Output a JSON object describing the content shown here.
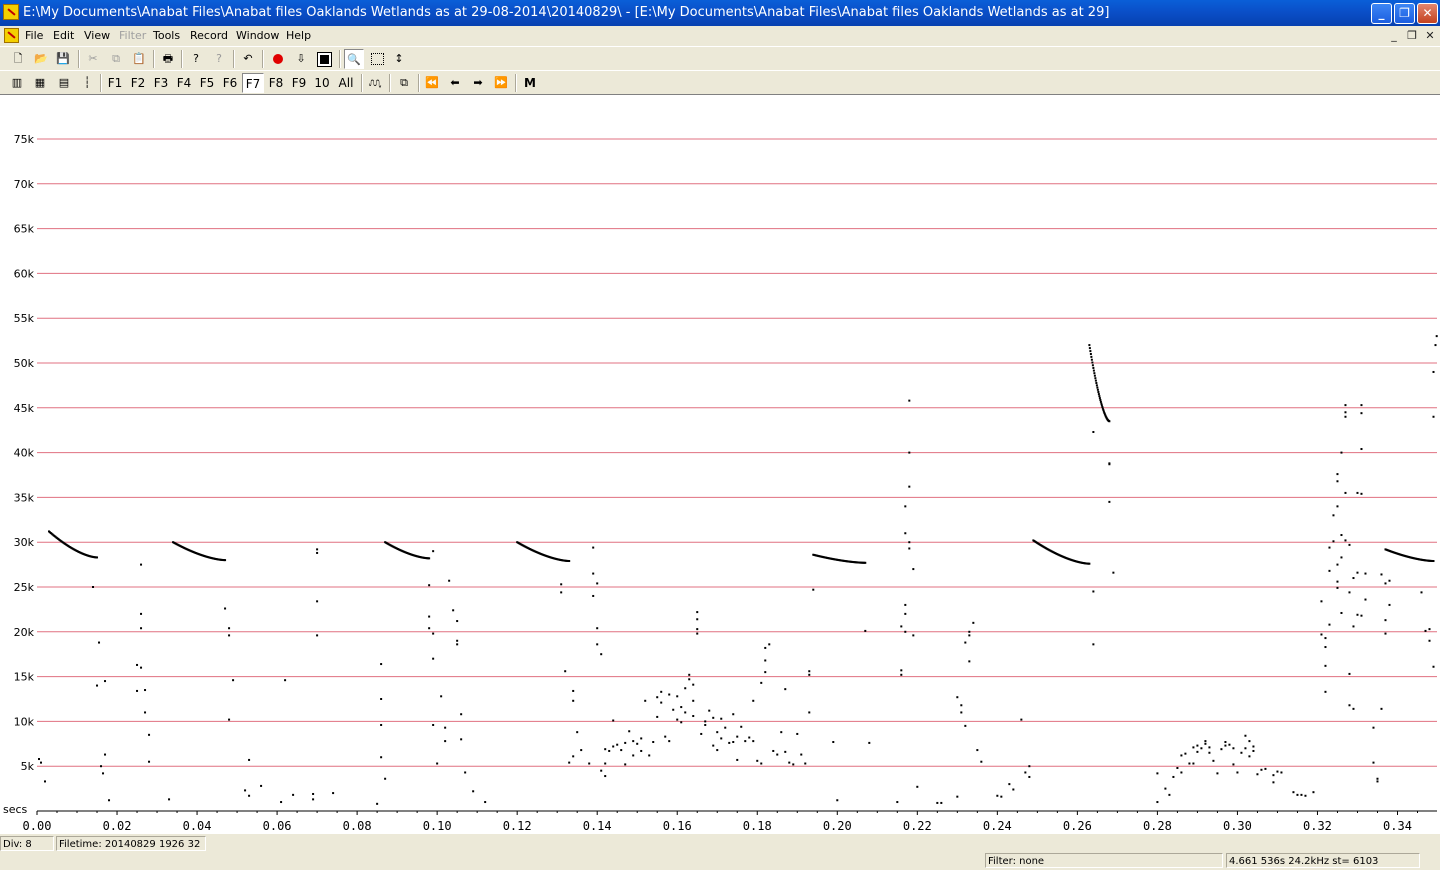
{
  "window": {
    "title": "E:\\My Documents\\Anabat Files\\Anabat files Oaklands Wetlands as at 29-08-2014\\20140829\\ - [E:\\My Documents\\Anabat Files\\Anabat files Oaklands Wetlands as at 29]",
    "controls": [
      "minimize",
      "maximize",
      "close"
    ]
  },
  "menu": {
    "items": [
      "File",
      "Edit",
      "View",
      "Filter",
      "Tools",
      "Record",
      "Window",
      "Help"
    ],
    "disabled": [
      "Filter"
    ]
  },
  "toolbar1": {
    "icons": [
      "new-file-icon",
      "open-folder-icon",
      "save-icon",
      "cut-icon",
      "copy-icon",
      "paste-icon",
      "print-icon",
      "help-icon",
      "context-help-icon",
      "undo-icon",
      "record-icon",
      "download-icon",
      "stop-icon",
      "zoom-icon",
      "select-rect-icon",
      "vertical-arrow-icon"
    ]
  },
  "toolbar2": {
    "view_icons": [
      "view-mode-1-icon",
      "view-mode-2-icon",
      "view-mode-3-icon",
      "view-mode-4-icon"
    ],
    "file_buttons": [
      "F1",
      "F2",
      "F3",
      "F4",
      "F5",
      "F6",
      "F7",
      "F8",
      "F9",
      "10",
      "All"
    ],
    "active_file": "F7",
    "nav_icons": [
      "call-shape-icon",
      "compare-icon",
      "first-icon",
      "prev-icon",
      "next-icon",
      "last-icon"
    ],
    "m_label": "M"
  },
  "chart_data": {
    "type": "scatter",
    "xlabel": "secs",
    "ylabel": "",
    "xlim": [
      0.0,
      0.35
    ],
    "ylim": [
      0,
      80000
    ],
    "x_ticks": [
      "0.00",
      "0.02",
      "0.04",
      "0.06",
      "0.08",
      "0.10",
      "0.12",
      "0.14",
      "0.16",
      "0.18",
      "0.20",
      "0.22",
      "0.24",
      "0.26",
      "0.28",
      "0.30",
      "0.32",
      "0.34"
    ],
    "y_ticks": [
      "5k",
      "10k",
      "15k",
      "20k",
      "25k",
      "30k",
      "35k",
      "40k",
      "45k",
      "50k",
      "55k",
      "60k",
      "65k",
      "70k",
      "75k"
    ],
    "grid": true,
    "grid_color": "#e07080",
    "calls": [
      {
        "x_start": 0.003,
        "x_end": 0.015,
        "f_start": 31200,
        "f_end": 28300
      },
      {
        "x_start": 0.034,
        "x_end": 0.047,
        "f_start": 30000,
        "f_end": 28000
      },
      {
        "x_start": 0.087,
        "x_end": 0.098,
        "f_start": 30000,
        "f_end": 28200
      },
      {
        "x_start": 0.12,
        "x_end": 0.133,
        "f_start": 30000,
        "f_end": 27900
      },
      {
        "x_start": 0.194,
        "x_end": 0.207,
        "f_start": 28600,
        "f_end": 27700
      },
      {
        "x_start": 0.249,
        "x_end": 0.263,
        "f_start": 30200,
        "f_end": 27600
      },
      {
        "x_start": 0.263,
        "x_end": 0.268,
        "f_start": 52000,
        "f_end": 43500
      },
      {
        "x_start": 0.337,
        "x_end": 0.349,
        "f_start": 29200,
        "f_end": 27900
      }
    ],
    "noise_points": [
      [
        0.0005,
        5800
      ],
      [
        0.001,
        5400
      ],
      [
        0.002,
        3300
      ],
      [
        0.014,
        25000
      ],
      [
        0.015,
        14000
      ],
      [
        0.0155,
        18800
      ],
      [
        0.016,
        5000
      ],
      [
        0.0165,
        4200
      ],
      [
        0.017,
        6300
      ],
      [
        0.017,
        14500
      ],
      [
        0.018,
        1200
      ],
      [
        0.025,
        13400
      ],
      [
        0.025,
        16300
      ],
      [
        0.026,
        16000
      ],
      [
        0.026,
        27500
      ],
      [
        0.026,
        22000
      ],
      [
        0.026,
        20400
      ],
      [
        0.027,
        13500
      ],
      [
        0.027,
        11000
      ],
      [
        0.028,
        8500
      ],
      [
        0.028,
        5500
      ],
      [
        0.033,
        1300
      ],
      [
        0.047,
        22600
      ],
      [
        0.048,
        20400
      ],
      [
        0.048,
        19600
      ],
      [
        0.048,
        10200
      ],
      [
        0.049,
        14600
      ],
      [
        0.052,
        2300
      ],
      [
        0.053,
        1700
      ],
      [
        0.053,
        5700
      ],
      [
        0.056,
        2800
      ],
      [
        0.061,
        1000
      ],
      [
        0.062,
        14600
      ],
      [
        0.064,
        1800
      ],
      [
        0.069,
        1300
      ],
      [
        0.069,
        1900
      ],
      [
        0.07,
        29200
      ],
      [
        0.07,
        28800
      ],
      [
        0.07,
        23400
      ],
      [
        0.07,
        19600
      ],
      [
        0.074,
        2000
      ],
      [
        0.085,
        800
      ],
      [
        0.086,
        6000
      ],
      [
        0.086,
        9600
      ],
      [
        0.086,
        12500
      ],
      [
        0.086,
        16400
      ],
      [
        0.087,
        3600
      ],
      [
        0.098,
        25200
      ],
      [
        0.098,
        21700
      ],
      [
        0.098,
        20400
      ],
      [
        0.099,
        29000
      ],
      [
        0.099,
        19800
      ],
      [
        0.099,
        17000
      ],
      [
        0.099,
        9600
      ],
      [
        0.1,
        5300
      ],
      [
        0.101,
        12800
      ],
      [
        0.102,
        9300
      ],
      [
        0.102,
        7800
      ],
      [
        0.103,
        25700
      ],
      [
        0.104,
        22400
      ],
      [
        0.105,
        21200
      ],
      [
        0.105,
        18600
      ],
      [
        0.105,
        19000
      ],
      [
        0.106,
        8000
      ],
      [
        0.106,
        10800
      ],
      [
        0.107,
        4300
      ],
      [
        0.109,
        2200
      ],
      [
        0.112,
        1000
      ],
      [
        0.131,
        24400
      ],
      [
        0.131,
        25300
      ],
      [
        0.132,
        15600
      ],
      [
        0.133,
        5400
      ],
      [
        0.134,
        6100
      ],
      [
        0.134,
        13400
      ],
      [
        0.134,
        12300
      ],
      [
        0.135,
        8800
      ],
      [
        0.136,
        6800
      ],
      [
        0.138,
        5300
      ],
      [
        0.139,
        29400
      ],
      [
        0.139,
        24000
      ],
      [
        0.139,
        26500
      ],
      [
        0.14,
        25400
      ],
      [
        0.14,
        20400
      ],
      [
        0.14,
        18600
      ],
      [
        0.141,
        17500
      ],
      [
        0.141,
        4500
      ],
      [
        0.142,
        3900
      ],
      [
        0.142,
        5300
      ],
      [
        0.142,
        6900
      ],
      [
        0.143,
        6700
      ],
      [
        0.144,
        10100
      ],
      [
        0.144,
        7200
      ],
      [
        0.145,
        7400
      ],
      [
        0.146,
        6800
      ],
      [
        0.147,
        5200
      ],
      [
        0.147,
        7600
      ],
      [
        0.148,
        8900
      ],
      [
        0.149,
        6200
      ],
      [
        0.149,
        7800
      ],
      [
        0.15,
        7500
      ],
      [
        0.151,
        6700
      ],
      [
        0.151,
        8100
      ],
      [
        0.152,
        12300
      ],
      [
        0.153,
        6200
      ],
      [
        0.154,
        7700
      ],
      [
        0.155,
        12700
      ],
      [
        0.155,
        10500
      ],
      [
        0.156,
        13300
      ],
      [
        0.156,
        12100
      ],
      [
        0.157,
        8300
      ],
      [
        0.158,
        13000
      ],
      [
        0.158,
        7800
      ],
      [
        0.159,
        11300
      ],
      [
        0.16,
        12800
      ],
      [
        0.16,
        10200
      ],
      [
        0.161,
        9900
      ],
      [
        0.161,
        11600
      ],
      [
        0.162,
        13700
      ],
      [
        0.162,
        11000
      ],
      [
        0.163,
        14700
      ],
      [
        0.163,
        15200
      ],
      [
        0.164,
        14100
      ],
      [
        0.164,
        12300
      ],
      [
        0.164,
        10600
      ],
      [
        0.165,
        20300
      ],
      [
        0.165,
        21400
      ],
      [
        0.165,
        22200
      ],
      [
        0.165,
        19800
      ],
      [
        0.166,
        8600
      ],
      [
        0.167,
        10000
      ],
      [
        0.167,
        9600
      ],
      [
        0.168,
        11200
      ],
      [
        0.169,
        10400
      ],
      [
        0.169,
        7300
      ],
      [
        0.17,
        8800
      ],
      [
        0.17,
        6800
      ],
      [
        0.171,
        8100
      ],
      [
        0.171,
        10300
      ],
      [
        0.172,
        9300
      ],
      [
        0.173,
        7600
      ],
      [
        0.174,
        7700
      ],
      [
        0.174,
        10800
      ],
      [
        0.175,
        8300
      ],
      [
        0.175,
        5700
      ],
      [
        0.176,
        9400
      ],
      [
        0.177,
        7800
      ],
      [
        0.178,
        8200
      ],
      [
        0.179,
        7800
      ],
      [
        0.179,
        12300
      ],
      [
        0.18,
        5600
      ],
      [
        0.181,
        5300
      ],
      [
        0.181,
        14300
      ],
      [
        0.182,
        15500
      ],
      [
        0.182,
        16800
      ],
      [
        0.182,
        18200
      ],
      [
        0.183,
        18600
      ],
      [
        0.184,
        6700
      ],
      [
        0.185,
        6300
      ],
      [
        0.186,
        8800
      ],
      [
        0.187,
        13600
      ],
      [
        0.187,
        6600
      ],
      [
        0.188,
        5400
      ],
      [
        0.189,
        5200
      ],
      [
        0.19,
        8600
      ],
      [
        0.191,
        6300
      ],
      [
        0.192,
        5300
      ],
      [
        0.193,
        11000
      ],
      [
        0.193,
        15600
      ],
      [
        0.193,
        15200
      ],
      [
        0.194,
        24700
      ],
      [
        0.199,
        7700
      ],
      [
        0.2,
        1200
      ],
      [
        0.207,
        20100
      ],
      [
        0.208,
        7600
      ],
      [
        0.215,
        1000
      ],
      [
        0.216,
        15200
      ],
      [
        0.216,
        15700
      ],
      [
        0.216,
        20600
      ],
      [
        0.217,
        20000
      ],
      [
        0.217,
        23000
      ],
      [
        0.217,
        22000
      ],
      [
        0.217,
        34000
      ],
      [
        0.217,
        31000
      ],
      [
        0.218,
        36200
      ],
      [
        0.218,
        45800
      ],
      [
        0.218,
        40000
      ],
      [
        0.218,
        30000
      ],
      [
        0.218,
        29300
      ],
      [
        0.219,
        27000
      ],
      [
        0.219,
        19600
      ],
      [
        0.22,
        2700
      ],
      [
        0.225,
        900
      ],
      [
        0.226,
        900
      ],
      [
        0.23,
        1600
      ],
      [
        0.23,
        12700
      ],
      [
        0.231,
        11800
      ],
      [
        0.231,
        11000
      ],
      [
        0.232,
        9500
      ],
      [
        0.232,
        18800
      ],
      [
        0.233,
        16700
      ],
      [
        0.233,
        20000
      ],
      [
        0.233,
        19600
      ],
      [
        0.234,
        21000
      ],
      [
        0.235,
        6800
      ],
      [
        0.236,
        5500
      ],
      [
        0.24,
        1700
      ],
      [
        0.241,
        1600
      ],
      [
        0.243,
        3000
      ],
      [
        0.244,
        2400
      ],
      [
        0.246,
        10200
      ],
      [
        0.247,
        4300
      ],
      [
        0.248,
        3800
      ],
      [
        0.248,
        5000
      ],
      [
        0.264,
        18600
      ],
      [
        0.264,
        24500
      ],
      [
        0.264,
        42300
      ],
      [
        0.268,
        38700
      ],
      [
        0.268,
        38800
      ],
      [
        0.268,
        34500
      ],
      [
        0.269,
        26600
      ],
      [
        0.28,
        4200
      ],
      [
        0.28,
        1000
      ],
      [
        0.282,
        2500
      ],
      [
        0.283,
        1800
      ],
      [
        0.284,
        3800
      ],
      [
        0.285,
        4800
      ],
      [
        0.286,
        4300
      ],
      [
        0.286,
        6200
      ],
      [
        0.287,
        6400
      ],
      [
        0.288,
        5300
      ],
      [
        0.289,
        5300
      ],
      [
        0.289,
        7100
      ],
      [
        0.29,
        7300
      ],
      [
        0.29,
        6600
      ],
      [
        0.291,
        7000
      ],
      [
        0.292,
        7800
      ],
      [
        0.292,
        7500
      ],
      [
        0.293,
        7100
      ],
      [
        0.293,
        6500
      ],
      [
        0.294,
        5600
      ],
      [
        0.295,
        4200
      ],
      [
        0.296,
        6900
      ],
      [
        0.297,
        7700
      ],
      [
        0.297,
        7300
      ],
      [
        0.298,
        7400
      ],
      [
        0.299,
        7000
      ],
      [
        0.299,
        5200
      ],
      [
        0.3,
        4300
      ],
      [
        0.301,
        6500
      ],
      [
        0.302,
        7000
      ],
      [
        0.302,
        8400
      ],
      [
        0.303,
        7800
      ],
      [
        0.303,
        6100
      ],
      [
        0.304,
        6700
      ],
      [
        0.304,
        7200
      ],
      [
        0.305,
        4100
      ],
      [
        0.306,
        4600
      ],
      [
        0.307,
        4700
      ],
      [
        0.309,
        3200
      ],
      [
        0.309,
        4000
      ],
      [
        0.31,
        4400
      ],
      [
        0.311,
        4300
      ],
      [
        0.314,
        2100
      ],
      [
        0.315,
        1800
      ],
      [
        0.316,
        1800
      ],
      [
        0.317,
        1700
      ],
      [
        0.319,
        2100
      ],
      [
        0.321,
        23400
      ],
      [
        0.321,
        19700
      ],
      [
        0.322,
        19300
      ],
      [
        0.322,
        18300
      ],
      [
        0.322,
        16200
      ],
      [
        0.322,
        13300
      ],
      [
        0.323,
        20800
      ],
      [
        0.323,
        26800
      ],
      [
        0.323,
        29400
      ],
      [
        0.324,
        30100
      ],
      [
        0.324,
        33000
      ],
      [
        0.325,
        36800
      ],
      [
        0.325,
        37600
      ],
      [
        0.325,
        34000
      ],
      [
        0.325,
        24900
      ],
      [
        0.325,
        25600
      ],
      [
        0.325,
        27500
      ],
      [
        0.326,
        40000
      ],
      [
        0.326,
        28300
      ],
      [
        0.326,
        22100
      ],
      [
        0.326,
        30800
      ],
      [
        0.327,
        44500
      ],
      [
        0.327,
        45300
      ],
      [
        0.327,
        44000
      ],
      [
        0.327,
        35500
      ],
      [
        0.327,
        30200
      ],
      [
        0.328,
        29700
      ],
      [
        0.328,
        24400
      ],
      [
        0.328,
        15300
      ],
      [
        0.328,
        11800
      ],
      [
        0.329,
        11400
      ],
      [
        0.329,
        20600
      ],
      [
        0.329,
        26000
      ],
      [
        0.33,
        35500
      ],
      [
        0.33,
        26600
      ],
      [
        0.33,
        21900
      ],
      [
        0.331,
        45300
      ],
      [
        0.331,
        44400
      ],
      [
        0.331,
        40400
      ],
      [
        0.331,
        35400
      ],
      [
        0.331,
        21800
      ],
      [
        0.332,
        26500
      ],
      [
        0.332,
        23600
      ],
      [
        0.334,
        9300
      ],
      [
        0.334,
        5400
      ],
      [
        0.335,
        3300
      ],
      [
        0.335,
        3600
      ],
      [
        0.336,
        11400
      ],
      [
        0.336,
        26400
      ],
      [
        0.337,
        25400
      ],
      [
        0.337,
        21300
      ],
      [
        0.337,
        19800
      ],
      [
        0.338,
        23000
      ],
      [
        0.338,
        25700
      ],
      [
        0.346,
        24400
      ],
      [
        0.347,
        20100
      ],
      [
        0.348,
        20300
      ],
      [
        0.348,
        19000
      ],
      [
        0.349,
        16100
      ],
      [
        0.349,
        44000
      ],
      [
        0.349,
        49000
      ],
      [
        0.3495,
        52000
      ],
      [
        0.3498,
        53000
      ]
    ]
  },
  "status": {
    "div": "Div: 8",
    "filetime": "Filetime: 20140829 1926 32",
    "filter": "Filter: none",
    "info": "4.661 536s  24.2kHz st=  6103"
  }
}
